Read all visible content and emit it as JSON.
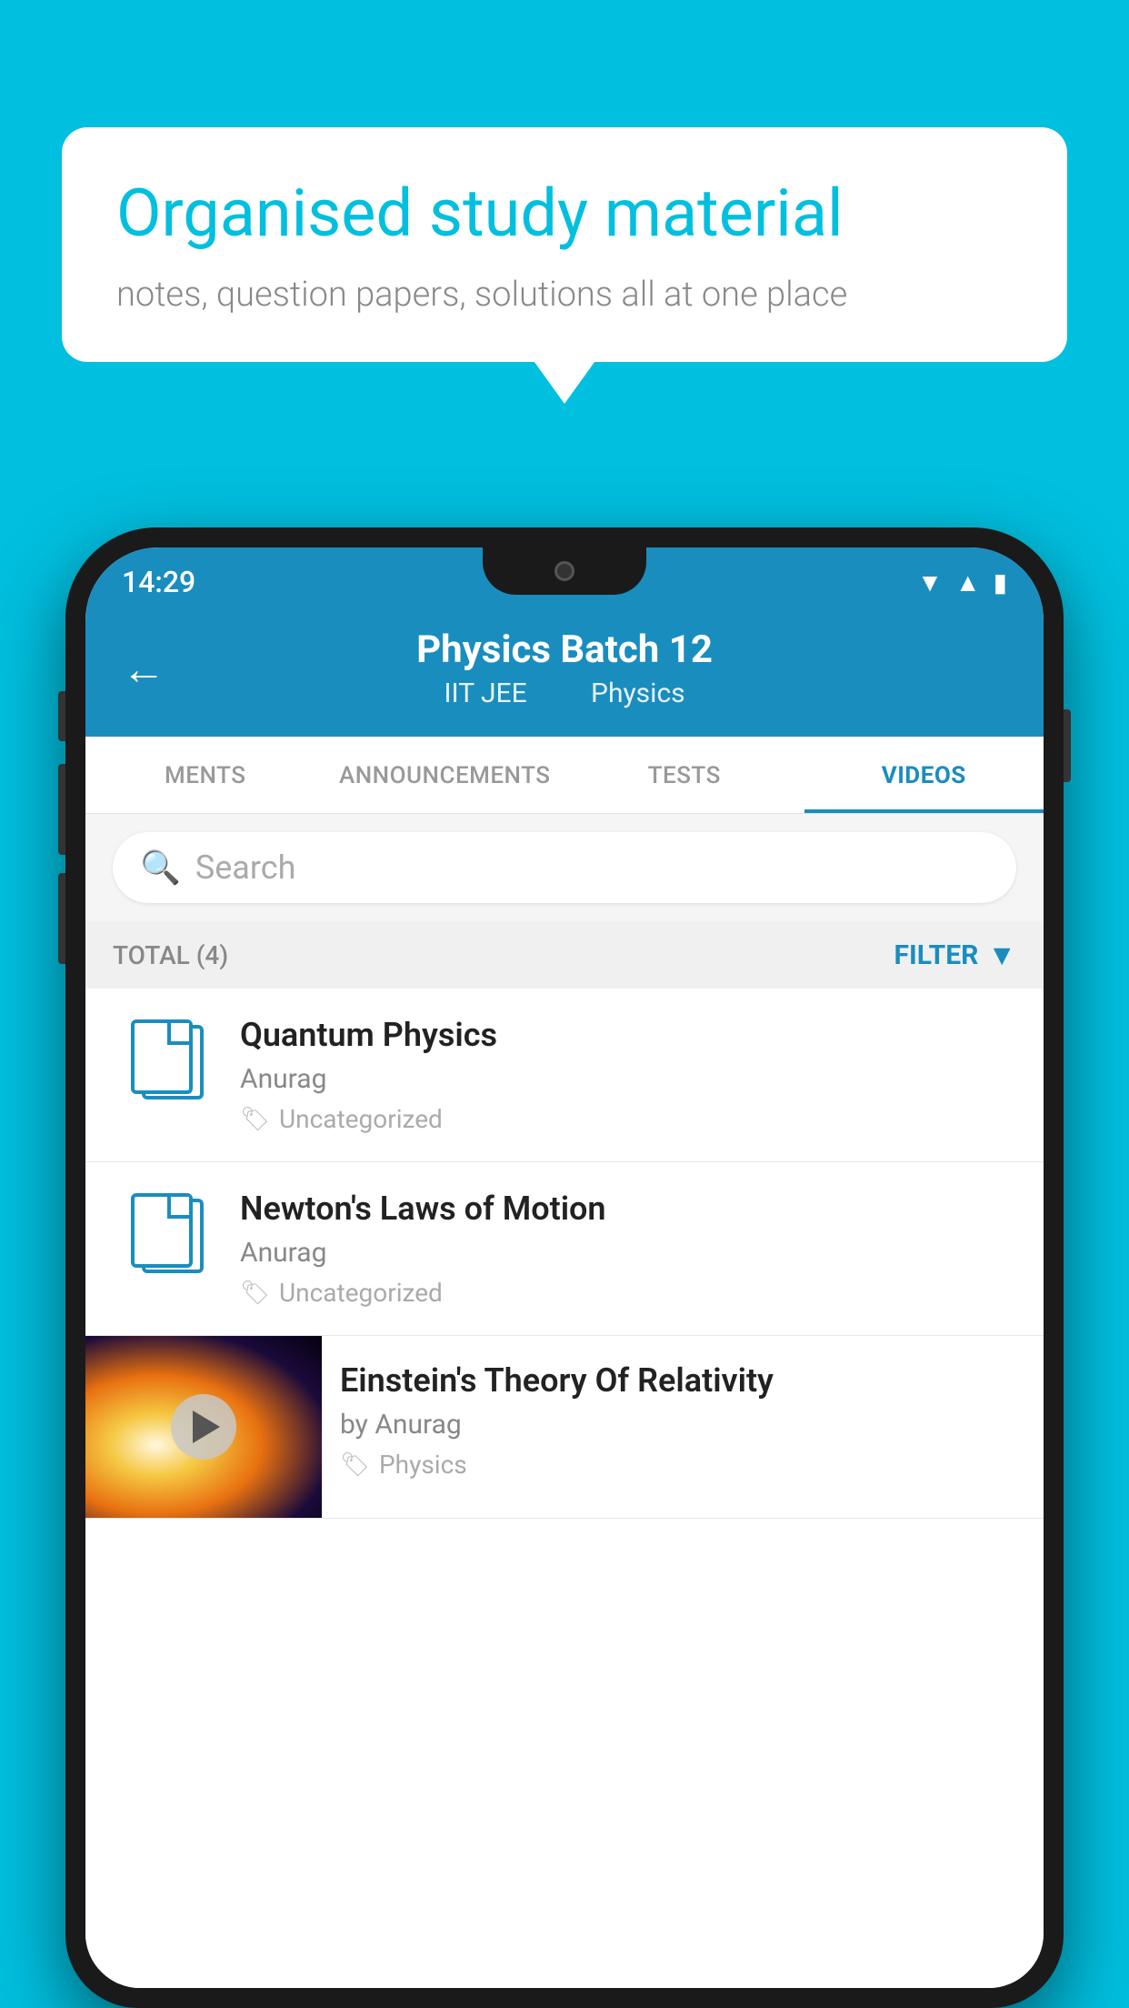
{
  "background_color": "#00BFDF",
  "speech_bubble": {
    "title": "Organised study material",
    "subtitle": "notes, question papers, solutions all at one place"
  },
  "phone": {
    "status_bar": {
      "time": "14:29",
      "icons": [
        "wifi",
        "signal",
        "battery"
      ]
    },
    "header": {
      "back_label": "←",
      "title": "Physics Batch 12",
      "subtitle_part1": "IIT JEE",
      "subtitle_part2": "Physics"
    },
    "tabs": [
      {
        "label": "MENTS",
        "active": false
      },
      {
        "label": "ANNOUNCEMENTS",
        "active": false
      },
      {
        "label": "TESTS",
        "active": false
      },
      {
        "label": "VIDEOS",
        "active": true
      }
    ],
    "search": {
      "placeholder": "Search"
    },
    "filter_row": {
      "total_label": "TOTAL (4)",
      "filter_label": "FILTER"
    },
    "video_items": [
      {
        "type": "document",
        "title": "Quantum Physics",
        "author": "Anurag",
        "tag": "Uncategorized"
      },
      {
        "type": "document",
        "title": "Newton's Laws of Motion",
        "author": "Anurag",
        "tag": "Uncategorized"
      },
      {
        "type": "thumbnail",
        "title": "Einstein's Theory Of Relativity",
        "author": "by Anurag",
        "tag": "Physics"
      }
    ]
  }
}
